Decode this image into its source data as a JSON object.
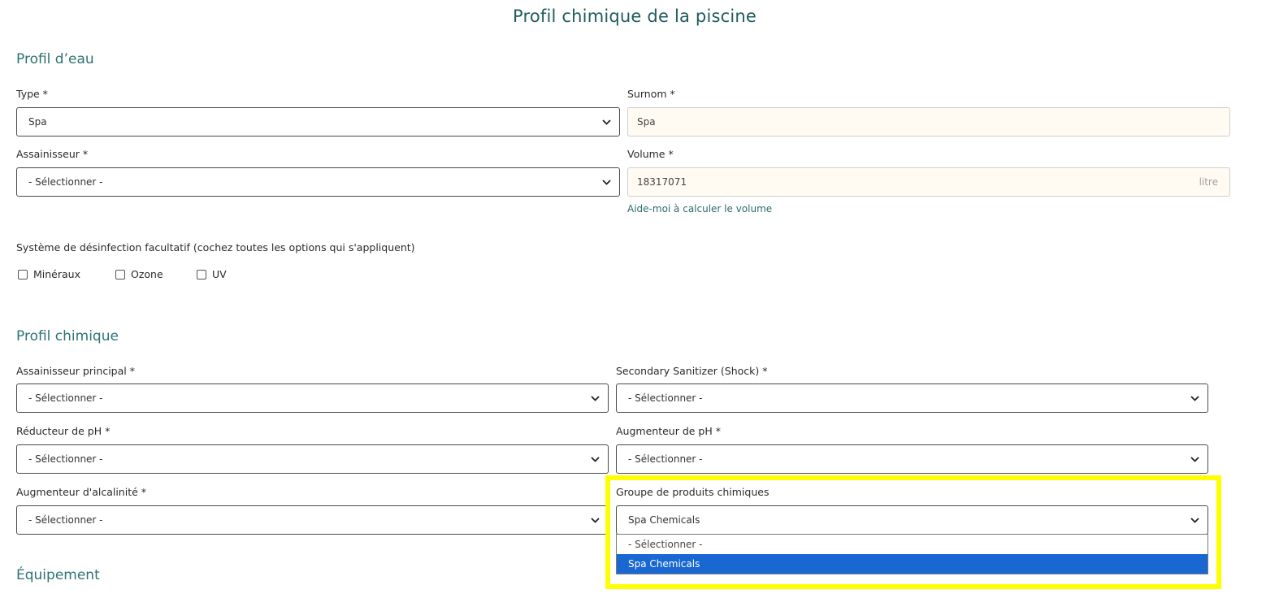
{
  "page_title": "Profil chimique de la piscine",
  "water_profile": {
    "title": "Profil d’eau",
    "type_label": "Type *",
    "type_value": "Spa",
    "nickname_label": "Surnom *",
    "nickname_value": "Spa",
    "sanitizer_label": "Assainisseur *",
    "sanitizer_value": "- Sélectionner -",
    "volume_label": "Volume *",
    "volume_value": "18317071",
    "volume_unit": "litre",
    "volume_help_link": "Aide-moi à calculer le volume",
    "optional_disinfection_label": "Système de désinfection facultatif (cochez toutes les options qui s'appliquent)",
    "options": [
      {
        "label": "Minéraux",
        "checked": false
      },
      {
        "label": "Ozone",
        "checked": false
      },
      {
        "label": "UV",
        "checked": false
      }
    ]
  },
  "chemical_profile": {
    "title": "Profil chimique",
    "primary_sanitizer_label": "Assainisseur principal *",
    "primary_sanitizer_value": "- Sélectionner -",
    "secondary_sanitizer_label": "Secondary Sanitizer (Shock) *",
    "secondary_sanitizer_value": "- Sélectionner -",
    "ph_reducer_label": "Réducteur de pH *",
    "ph_reducer_value": "- Sélectionner -",
    "ph_increaser_label": "Augmenteur de pH *",
    "ph_increaser_value": "- Sélectionner -",
    "alkalinity_label": "Augmenteur d'alcalinité *",
    "alkalinity_value": "- Sélectionner -",
    "chem_group_label": "Groupe de produits chimiques",
    "chem_group_value": "Spa Chemicals",
    "chem_group_options": [
      "- Sélectionner -",
      "Spa Chemicals"
    ],
    "chem_group_selected_index": 1
  },
  "equipment": {
    "title": "Équipement"
  },
  "icons": {
    "chevron": "chevron-down-icon"
  },
  "colors": {
    "section_title": "#2e7373",
    "highlight": "#ffff00",
    "selected_option": "#1967d2",
    "input_bg": "#fffbf2"
  }
}
